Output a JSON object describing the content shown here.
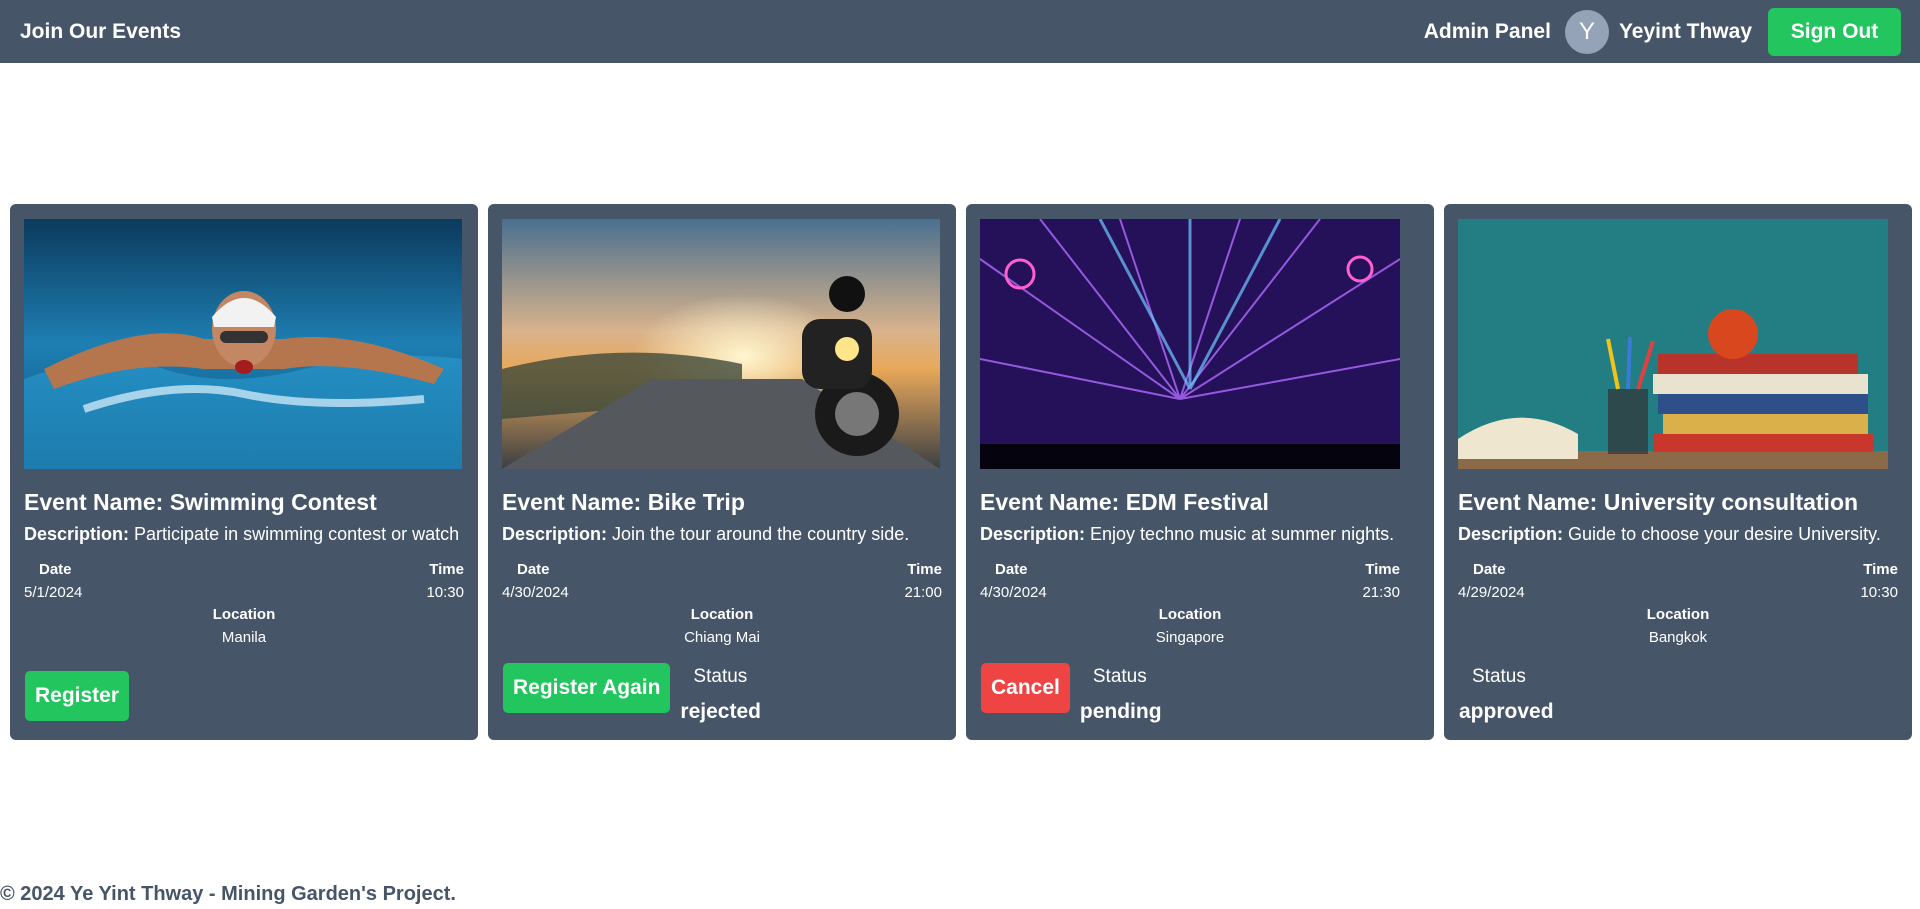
{
  "nav": {
    "brand": "Join Our Events",
    "admin_link": "Admin Panel",
    "avatar_initial": "Y",
    "user_name": "Yeyint Thway",
    "signout_label": "Sign Out"
  },
  "labels": {
    "event_name_prefix": "Event Name: ",
    "description_prefix": "Description:",
    "date": "Date",
    "time": "Time",
    "location": "Location",
    "status": "Status"
  },
  "events": [
    {
      "name": "Swimming Contest",
      "description": "Participate in swimming contest or watch",
      "date": "5/1/2024",
      "time": "10:30",
      "location": "Manila",
      "action_label": "Register",
      "action_color": "#22c55e",
      "status": "",
      "image_icon": "swimmer-photo"
    },
    {
      "name": "Bike Trip",
      "description": "Join the tour around the country side.",
      "date": "4/30/2024",
      "time": "21:00",
      "location": "Chiang Mai",
      "action_label": "Register Again",
      "action_color": "#22c55e",
      "status": "rejected",
      "image_icon": "motorcycle-photo"
    },
    {
      "name": "EDM Festival",
      "description": "Enjoy techno music at summer nights.",
      "date": "4/30/2024",
      "time": "21:30",
      "location": "Singapore",
      "action_label": "Cancel",
      "action_color": "#ef4444",
      "status": "pending",
      "image_icon": "concert-photo"
    },
    {
      "name": "University consultation",
      "description": "Guide to choose your desire University.",
      "date": "4/29/2024",
      "time": "10:30",
      "location": "Bangkok",
      "action_label": "",
      "action_color": "",
      "status": "approved",
      "image_icon": "books-apple-photo"
    }
  ],
  "footer": "© 2024 Ye Yint Thway - Mining Garden's Project."
}
